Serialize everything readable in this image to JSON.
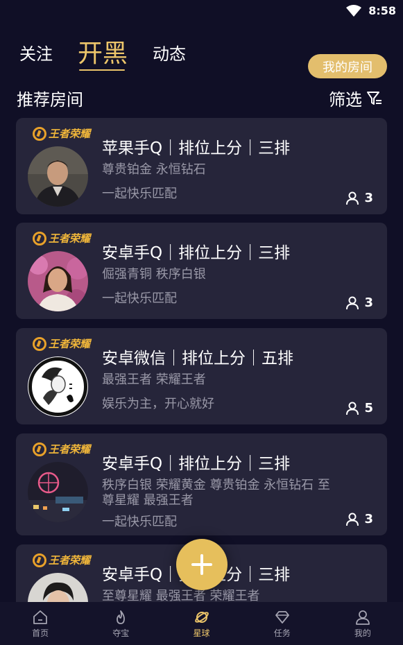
{
  "status_bar": {
    "time": "8:58"
  },
  "top_tabs": [
    {
      "label": "关注",
      "active": false
    },
    {
      "label": "开黑",
      "active": true
    },
    {
      "label": "动态",
      "active": false
    }
  ],
  "my_room_label": "我的房间",
  "section_title": "推荐房间",
  "filter_label": "筛选",
  "rooms": [
    {
      "game": "王者荣耀",
      "title": "苹果手Q｜排位上分｜三排",
      "tags": "尊贵铂金 永恒钻石",
      "desc": "一起快乐匹配",
      "count": "3"
    },
    {
      "game": "王者荣耀",
      "title": "安卓手Q｜排位上分｜三排",
      "tags": "倔强青铜 秩序白银",
      "desc": "一起快乐匹配",
      "count": "3"
    },
    {
      "game": "王者荣耀",
      "title": "安卓微信｜排位上分｜五排",
      "tags": "最强王者 荣耀王者",
      "desc": "娱乐为主，开心就好",
      "count": "5"
    },
    {
      "game": "王者荣耀",
      "title": "安卓手Q｜排位上分｜三排",
      "tags": "秩序白银 荣耀黄金 尊贵铂金 永恒钻石 至尊星耀 最强王者",
      "desc": "一起快乐匹配",
      "count": "3"
    },
    {
      "game": "王者荣耀",
      "title": "安卓手Q｜排位上分｜三排",
      "tags": "至尊星耀 最强王者 荣耀王者",
      "desc": "",
      "count": ""
    }
  ],
  "bottom_nav": [
    {
      "label": "首页",
      "icon": "home-icon",
      "active": false
    },
    {
      "label": "夺宝",
      "icon": "flame-icon",
      "active": false
    },
    {
      "label": "星球",
      "icon": "planet-icon",
      "active": true
    },
    {
      "label": "任务",
      "icon": "diamond-icon",
      "active": false
    },
    {
      "label": "我的",
      "icon": "profile-icon",
      "active": false
    }
  ],
  "colors": {
    "background": "#100f26",
    "card": "#26253a",
    "accent": "#ecc56a",
    "muted": "#9a99a8"
  }
}
